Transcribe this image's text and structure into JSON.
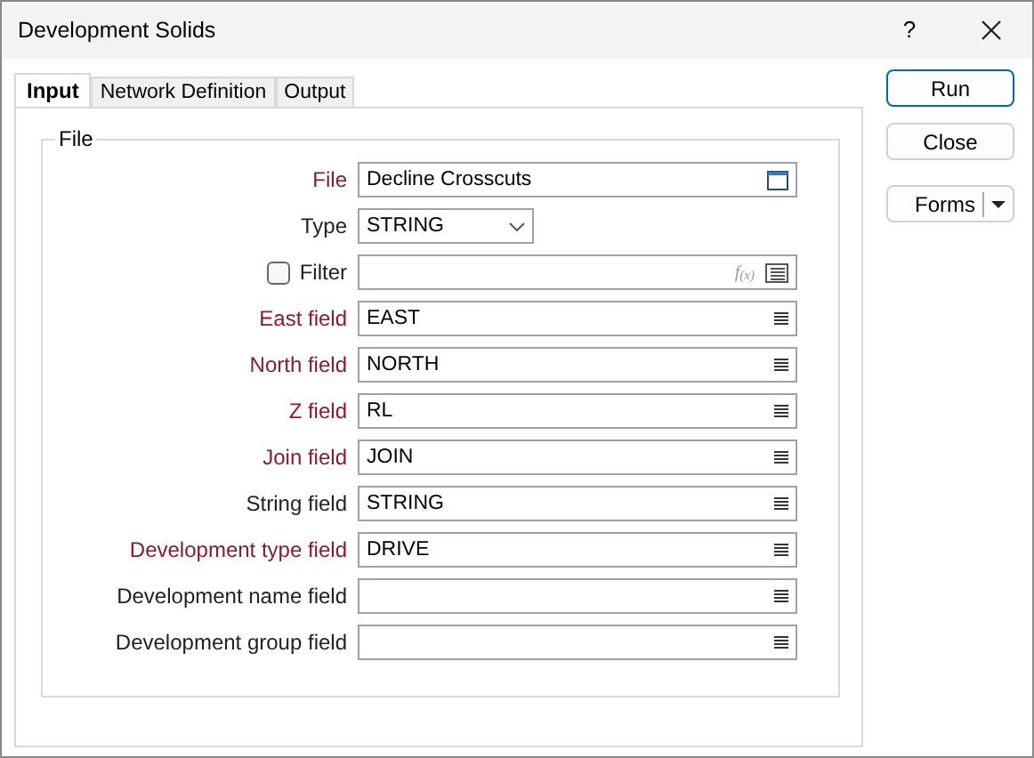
{
  "window": {
    "title": "Development Solids",
    "help": "?"
  },
  "tabs": [
    {
      "label": "Input",
      "selected": true
    },
    {
      "label": "Network Definition",
      "selected": false
    },
    {
      "label": "Output",
      "selected": false
    }
  ],
  "group": {
    "title": "File"
  },
  "rows": [
    {
      "kind": "file",
      "label": "File",
      "required": true,
      "value": "Decline Crosscuts"
    },
    {
      "kind": "select",
      "label": "Type",
      "required": false,
      "value": "STRING"
    },
    {
      "kind": "filter",
      "label": "Filter",
      "required": false,
      "checked": false,
      "value": "",
      "function_button": "f$_{(x)}$"
    },
    {
      "kind": "field",
      "label": "East field",
      "required": true,
      "value": "EAST"
    },
    {
      "kind": "field",
      "label": "North field",
      "required": true,
      "value": "NORTH"
    },
    {
      "kind": "field",
      "label": "Z field",
      "required": true,
      "value": "RL"
    },
    {
      "kind": "field",
      "label": "Join field",
      "required": true,
      "value": "JOIN"
    },
    {
      "kind": "field",
      "label": "String field",
      "required": false,
      "value": "STRING"
    },
    {
      "kind": "field",
      "label": "Development type field",
      "required": true,
      "value": "DRIVE"
    },
    {
      "kind": "field",
      "label": "Development name field",
      "required": false,
      "value": ""
    },
    {
      "kind": "field",
      "label": "Development group field",
      "required": false,
      "value": ""
    }
  ],
  "buttons": [
    {
      "kind": "primary",
      "label": "Run"
    },
    {
      "kind": "normal",
      "label": "Close"
    },
    {
      "kind": "split",
      "label": "Forms"
    }
  ]
}
